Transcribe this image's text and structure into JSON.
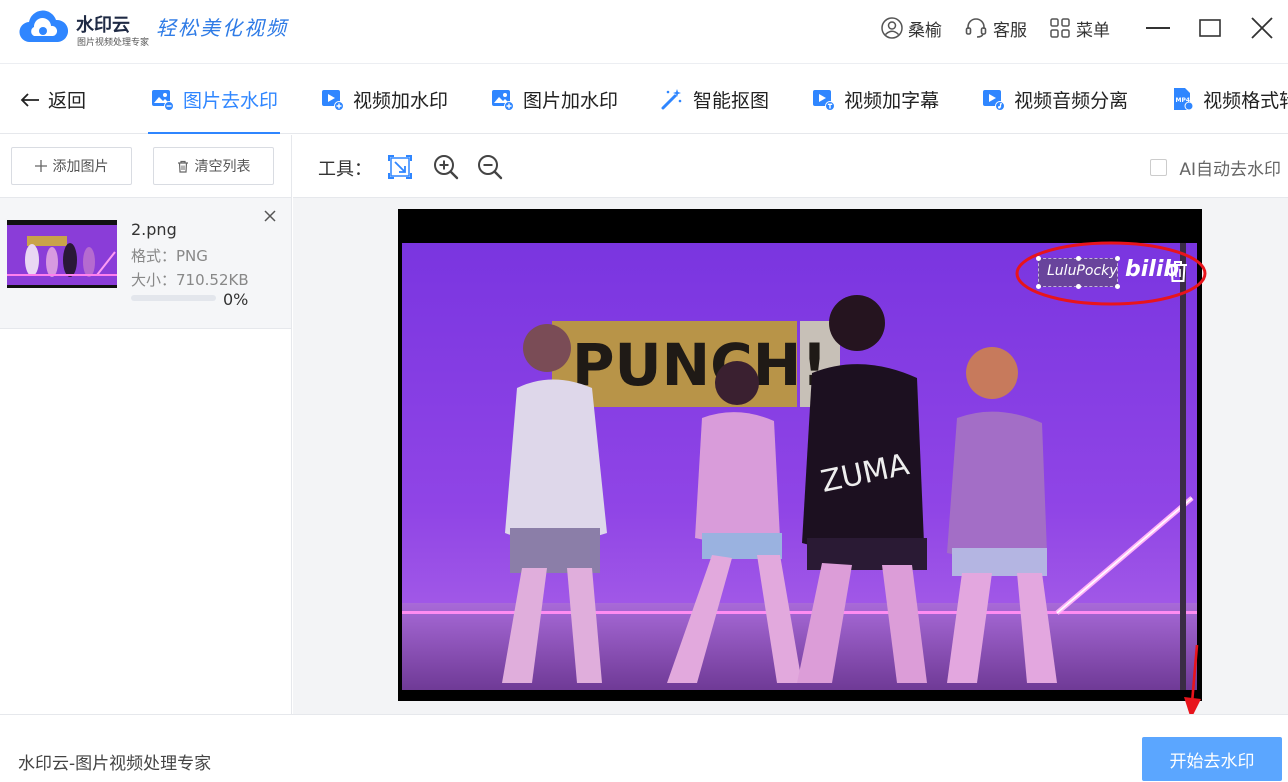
{
  "app": {
    "name": "水印云",
    "subtitle": "图片视频处理专家",
    "slogan": "轻松美化视频",
    "user": "桑榆",
    "service_label": "客服",
    "menu_label": "菜单"
  },
  "nav": {
    "back_label": "返回",
    "tabs": [
      {
        "label": "图片去水印",
        "active": true,
        "icon": "image-remove-icon"
      },
      {
        "label": "视频加水印",
        "active": false,
        "icon": "video-add-icon"
      },
      {
        "label": "图片加水印",
        "active": false,
        "icon": "image-add-icon"
      },
      {
        "label": "智能抠图",
        "active": false,
        "icon": "magic-wand-icon"
      },
      {
        "label": "视频加字幕",
        "active": false,
        "icon": "video-subtitle-icon"
      },
      {
        "label": "视频音频分离",
        "active": false,
        "icon": "video-audio-icon"
      },
      {
        "label": "视频格式转换",
        "active": false,
        "icon": "mp4-icon"
      }
    ]
  },
  "left_panel": {
    "add_label": "添加图片",
    "clear_label": "清空列表",
    "files": [
      {
        "name": "2.png",
        "format_label": "格式：PNG",
        "size_label": "大小：710.52KB",
        "progress": 0,
        "progress_text": "0%"
      }
    ]
  },
  "work": {
    "tool_label": "工具：",
    "ai_label": "AI自动去水印",
    "ai_checked": false,
    "watermark_text": "LuluPocky",
    "watermark_logo": "bilib",
    "photo_text": "PUNCH!"
  },
  "status": {
    "footer_text": "水印云-图片视频处理专家",
    "start_label": "开始去水印"
  },
  "colors": {
    "accent": "#2f86ff",
    "start_button": "#5ba6ff",
    "annotation_red": "#e8141c"
  }
}
